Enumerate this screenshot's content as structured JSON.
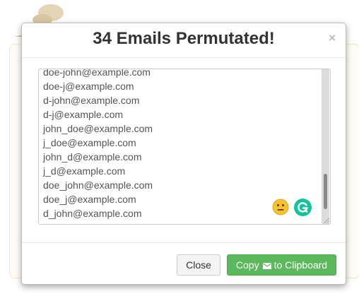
{
  "modal": {
    "title": "34 Emails Permutated!",
    "close_symbol": "×",
    "icons": [
      "close-icon",
      "emoji-neutral-icon",
      "grammarly-icon",
      "envelope-icon"
    ]
  },
  "emails": [
    "doe-john@example.com",
    "doe-j@example.com",
    "d-john@example.com",
    "d-j@example.com",
    "john_doe@example.com",
    "j_doe@example.com",
    "john_d@example.com",
    "j_d@example.com",
    "doe_john@example.com",
    "doe_j@example.com",
    "d_john@example.com"
  ],
  "footer": {
    "close_label": "Close",
    "copy_label_before": "Copy",
    "copy_label_after": "to Clipboard"
  },
  "colors": {
    "primary_green": "#5cb85c",
    "grammarly_green": "#15c39a",
    "emoji_yellow": "#f6c234"
  }
}
